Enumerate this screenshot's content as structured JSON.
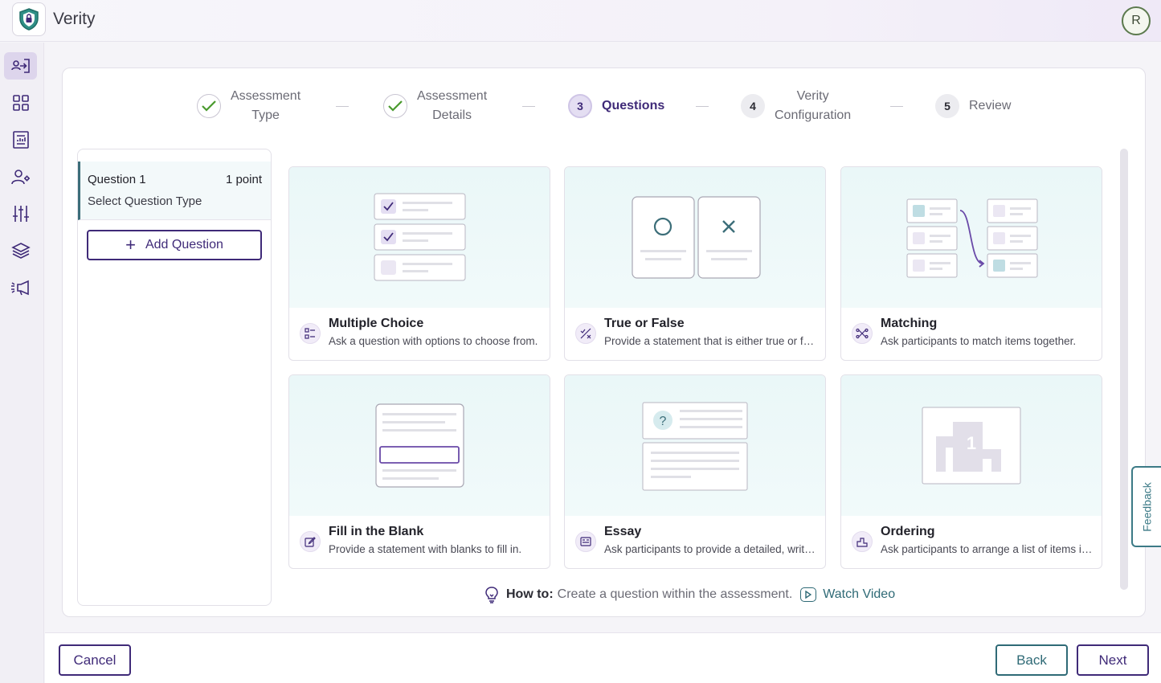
{
  "app": {
    "title": "Verity",
    "user_initial": "R"
  },
  "sidebar": {
    "items": [
      {
        "name": "assessments",
        "icon": "user-transfer-icon",
        "active": true
      },
      {
        "name": "dashboard",
        "icon": "grid-icon",
        "active": false
      },
      {
        "name": "reports",
        "icon": "report-icon",
        "active": false
      },
      {
        "name": "users",
        "icon": "user-settings-icon",
        "active": false
      },
      {
        "name": "settings",
        "icon": "sliders-icon",
        "active": false
      },
      {
        "name": "library",
        "icon": "layers-icon",
        "active": false
      },
      {
        "name": "announcements",
        "icon": "megaphone-icon",
        "active": false
      }
    ]
  },
  "stepper": {
    "steps": [
      {
        "number": "1",
        "line1": "Assessment",
        "line2": "Type",
        "status": "done"
      },
      {
        "number": "2",
        "line1": "Assessment",
        "line2": "Details",
        "status": "done"
      },
      {
        "number": "3",
        "line1": "Questions",
        "line2": "",
        "status": "current"
      },
      {
        "number": "4",
        "line1": "Verity",
        "line2": "Configuration",
        "status": "todo"
      },
      {
        "number": "5",
        "line1": "Review",
        "line2": "",
        "status": "todo"
      }
    ]
  },
  "question_list": {
    "items": [
      {
        "title": "Question 1",
        "points": "1 point",
        "subtitle": "Select Question Type"
      }
    ],
    "add_button": "Add Question"
  },
  "question_types": [
    {
      "id": "multiple-choice",
      "name": "Multiple Choice",
      "description": "Ask a question with options to choose from.",
      "icon": "checklist-icon"
    },
    {
      "id": "true-false",
      "name": "True or False",
      "description": "Provide a statement that is either true or false.",
      "icon": "true-false-icon"
    },
    {
      "id": "matching",
      "name": "Matching",
      "description": "Ask participants to match items together.",
      "icon": "matching-icon"
    },
    {
      "id": "fill-blank",
      "name": "Fill in the Blank",
      "description": "Provide a statement with blanks to fill in.",
      "icon": "edit-icon"
    },
    {
      "id": "essay",
      "name": "Essay",
      "description": "Ask participants to provide a detailed, written response.",
      "icon": "essay-icon"
    },
    {
      "id": "ordering",
      "name": "Ordering",
      "description": "Ask participants to arrange a list of items in order.",
      "icon": "podium-icon"
    }
  ],
  "howto": {
    "label": "How to:",
    "text": "Create a question within the assessment.",
    "link": "Watch Video"
  },
  "feedback": "Feedback",
  "footer": {
    "cancel": "Cancel",
    "back": "Back",
    "next": "Next"
  },
  "colors": {
    "primary": "#3f2a78",
    "accent": "#2f6a76",
    "done": "#4a9a2e"
  }
}
